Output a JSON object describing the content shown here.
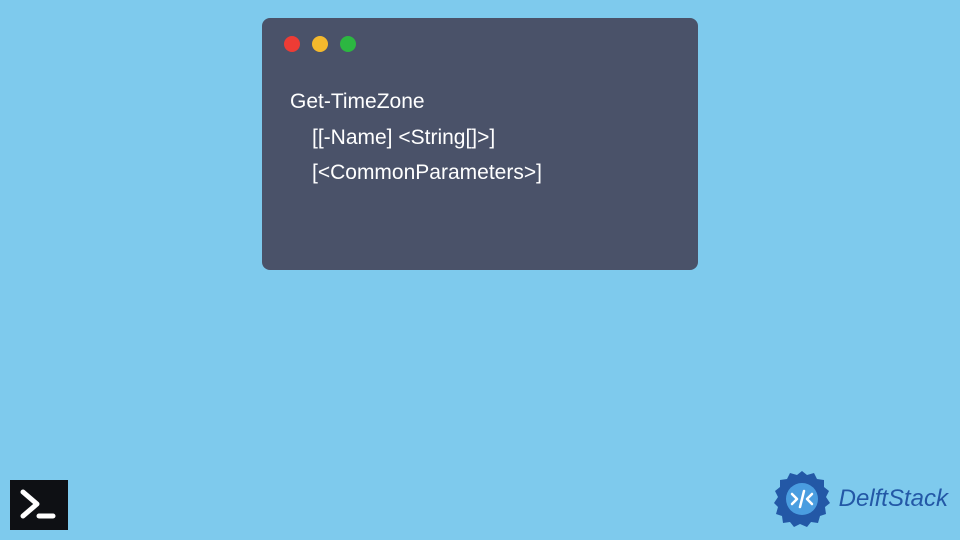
{
  "code": {
    "line1": "Get-TimeZone",
    "line2": "[[-Name] <String[]>]",
    "line3": "[<CommonParameters>]"
  },
  "brand": {
    "name": "DelftStack"
  },
  "colors": {
    "background": "#7ecaed",
    "window": "#4a5269",
    "red": "#ed3c35",
    "yellow": "#f4b92d",
    "green": "#2cb741",
    "brand_blue": "#2358a6"
  }
}
